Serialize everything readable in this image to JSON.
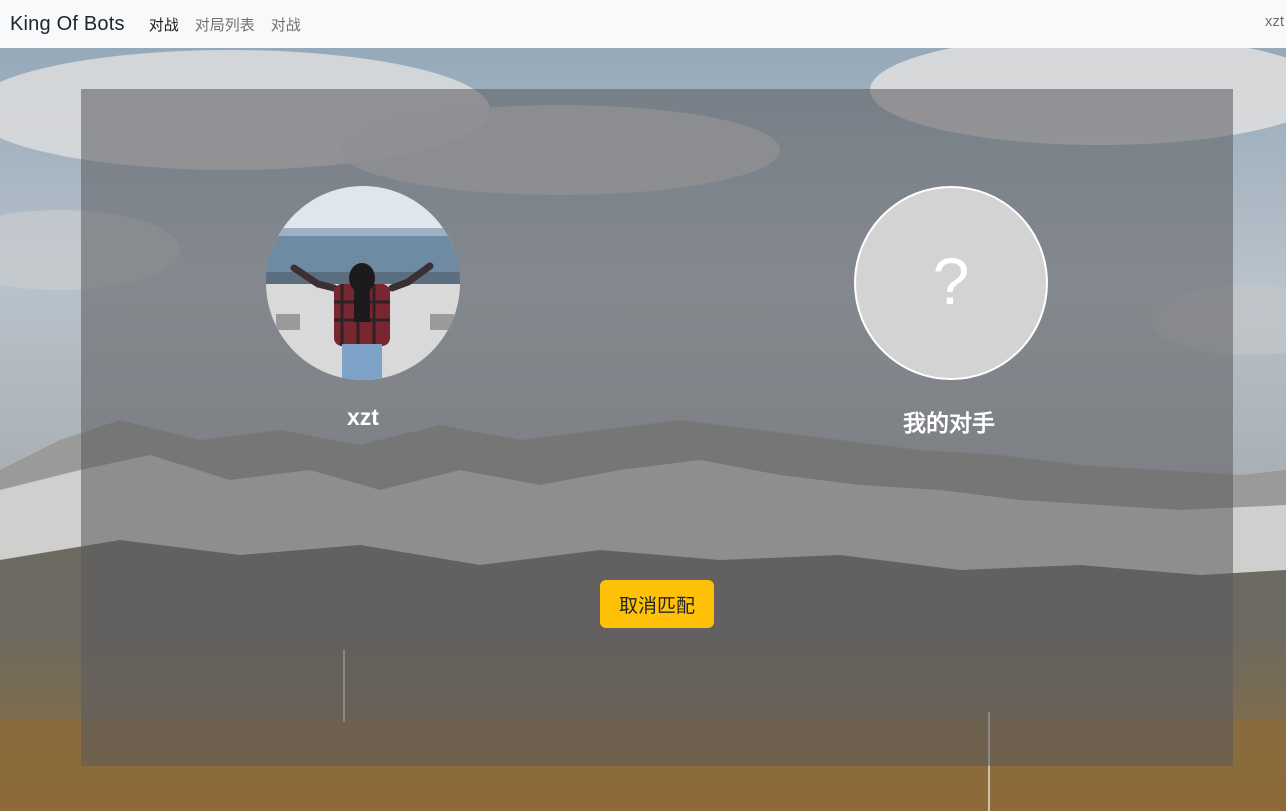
{
  "navbar": {
    "brand": "King Of Bots",
    "links": [
      "对战",
      "对局列表",
      "对战"
    ],
    "active_index": 0,
    "user": "xzt"
  },
  "match": {
    "self": {
      "name": "xzt",
      "avatar": "photo-of-person-with-raised-arms"
    },
    "opponent": {
      "name": "我的对手",
      "placeholder_symbol": "?"
    },
    "cancel_button": "取消匹配"
  },
  "colors": {
    "navbar_bg": "#f8f9fa",
    "button_bg": "#ffc107",
    "panel_overlay": "rgba(90,90,92,0.55)",
    "opponent_avatar_bg": "#d3d3d3"
  }
}
